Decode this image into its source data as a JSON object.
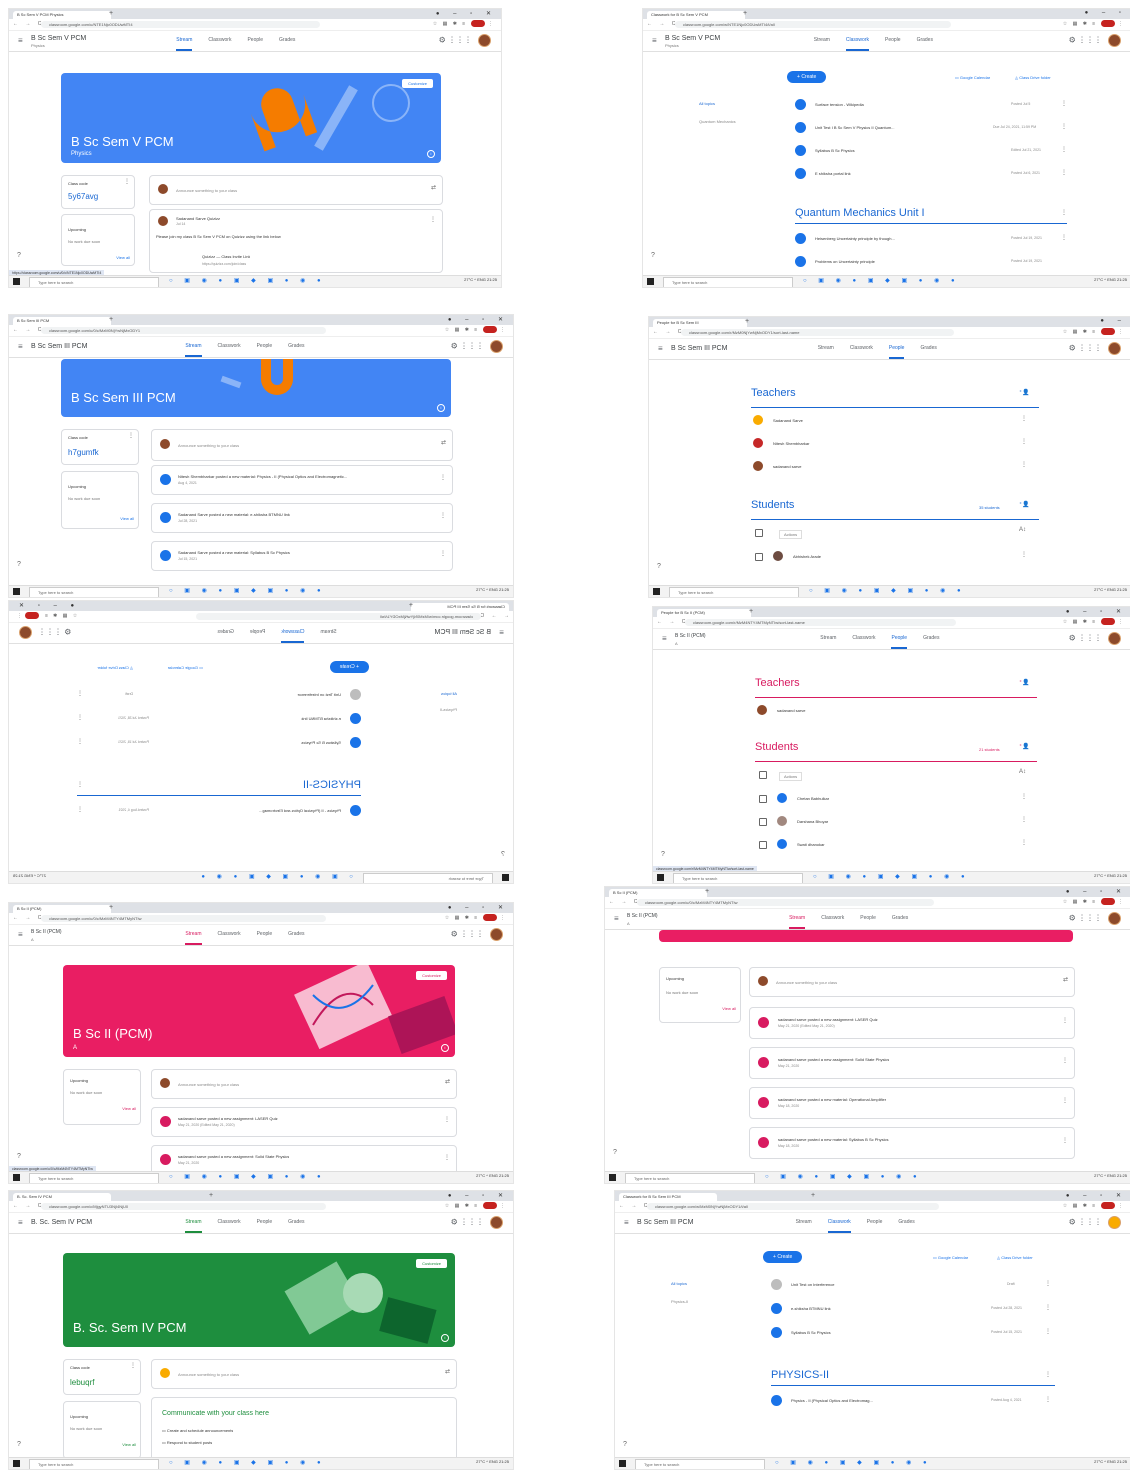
{
  "taskbar": {
    "search_placeholder": "Type here to search",
    "temp": "27°C",
    "lang": "ENG",
    "time": "21:25"
  },
  "common": {
    "tabs": [
      "Stream",
      "Classwork",
      "People",
      "Grades"
    ],
    "customize": "Customize",
    "view_all": "View all",
    "upcoming": "Upcoming",
    "no_work": "No work due soon",
    "class_code": "Class code",
    "announce": "Announce something to your class",
    "create": "Create",
    "google_calendar": "Google Calendar",
    "class_drive": "Class Drive folder",
    "all_topics": "All topics",
    "teachers": "Teachers",
    "students": "Students",
    "actions": "Actions"
  },
  "s1": {
    "tab": "B Sc Sem V PCM Physics",
    "url": "classroom.google.com/u/NTE1Njc0ODUwMTI4",
    "class": "B Sc Sem V PCM",
    "subject": "Physics",
    "code": "5y67avg",
    "post_author": "Sadanand Sarve Quizizz",
    "post_date": "Jul 14",
    "post_text": "Please join my class B Sc Sem V PCM on Quizizz using the link below",
    "post_link": "Quizizz — Class Invite Link",
    "post_url": "https://quizizz.com/join/class",
    "status_url": "https://classroom.google.com/u/0/c/NTE1Njc0ODUwMTI4"
  },
  "s2": {
    "tab": "Classwork for B Sc Sem V PCM",
    "url": "classroom.google.com/w/NTE1Njc0ODUwMTI4/t/all",
    "class": "B Sc Sem V PCM",
    "subject": "Physics",
    "topic_side": "Quantum Mechanics",
    "items": [
      {
        "t": "Surface tension - Wikipedia",
        "d": "Posted Jul 5"
      },
      {
        "t": "Unit Test I B Sc Sem V Physics II Quantum...",
        "d": "Due Jul 24, 2021, 11:59 PM"
      },
      {
        "t": "Syllabus B Sc Physics",
        "d": "Edited Jul 21, 2021"
      },
      {
        "t": "E shiksha portal link",
        "d": "Posted Jul 6, 2021"
      }
    ],
    "topic": "Quantum Mechanics Unit I",
    "titems": [
      {
        "t": "Heisenberg Uncertainty principle by though...",
        "d": "Posted Jul 19, 2021"
      },
      {
        "t": "Problems on Uncertainty principle",
        "d": "Posted Jul 19, 2021"
      }
    ]
  },
  "s3": {
    "tab": "B Sc Sem III PCM",
    "url": "classroom.google.com/u/0/c/MzM0NjYwNjMxODY1",
    "class": "B Sc Sem III PCM",
    "code": "h7gumfk",
    "posts": [
      {
        "t": "Nitesh Shembharkar posted a new material: Physics - II (Physical Optics and Electromagnetic...",
        "d": "Aug 4, 2021"
      },
      {
        "t": "Sadanand Sarve posted a new material: e-shiksha BTMNU link",
        "d": "Jul 28, 2021"
      },
      {
        "t": "Sadanand Sarve posted a new material: Syllabus B Sc Physics",
        "d": "Jul 15, 2021"
      }
    ]
  },
  "s4": {
    "tab": "People for B Sc Sem III",
    "url": "classroom.google.com/r/MzM0NjYwNjMxODY1/sort-last-name",
    "class": "B Sc Sem III PCM",
    "teachers": [
      "Sadanand Sarve",
      "Nitesh Shembharkar",
      "sadanand sarve"
    ],
    "students_count": "35 students",
    "students": [
      "Abhishek Arade",
      "Bhagyashri Bansod"
    ]
  },
  "s5": {
    "tab": "Classwork for B Sc Sem III PCM",
    "url": "classroom.google.com/w/MzM0NjYwNjMxODY1/t/all",
    "class": "B Sc Sem III PCM",
    "topic_side": "Physics-II",
    "items": [
      {
        "t": "Unit Test on Interference",
        "d": "Draft"
      },
      {
        "t": "e-shiksha BTMNU link",
        "d": "Posted Jul 28, 2021"
      },
      {
        "t": "Syllabus B Sc Physics",
        "d": "Posted Jul 15, 2021"
      }
    ],
    "topic": "PHYSICS-II",
    "titems": [
      {
        "t": "Physics - II (Physical Optics and Electromag...",
        "d": "Posted Aug 4, 2021"
      }
    ]
  },
  "s6": {
    "tab": "People for B Sc II (PCM)",
    "url": "classroom.google.com/r/MzM4NTY4MTMyNTIw/sort-last-name",
    "class": "B Sc II (PCM)",
    "section": "A",
    "teachers": [
      "sadanand sarve"
    ],
    "students_count": "21 students",
    "students": [
      "Chetan Babhulkar",
      "Darshana Bhoyar",
      "Swati dhanokar"
    ]
  },
  "s7": {
    "tab": "B Sc II (PCM)",
    "url": "classroom.google.com/u/0/c/MzM4NTY4MTMyNTIw",
    "class": "B Sc II (PCM)",
    "section": "A",
    "posts": [
      {
        "t": "sadanand sarve posted a new assignment: LASER Quiz",
        "d": "May 21, 2020 (Edited May 21, 2020)"
      },
      {
        "t": "sadanand sarve posted a new assignment: Solid State Physics",
        "d": "May 21, 2020"
      }
    ]
  },
  "s8": {
    "tab": "B Sc II (PCM)",
    "url": "classroom.google.com/u/0/c/MzM4NTY4MTMyNTIw",
    "class": "B Sc II (PCM)",
    "section": "A",
    "posts": [
      {
        "t": "sadanand sarve posted a new assignment: LASER Quiz",
        "d": "May 21, 2020 (Edited May 21, 2020)"
      },
      {
        "t": "sadanand sarve posted a new assignment: Solid State Physics",
        "d": "May 21, 2020"
      },
      {
        "t": "sadanand sarve posted a new material: Operational Amplifier",
        "d": "May 18, 2020"
      },
      {
        "t": "sadanand sarve posted a new material: Syllabus B Sc Physics",
        "d": "May 18, 2020"
      }
    ]
  },
  "s9": {
    "tab": "B. Sc. Sem IV PCM",
    "url": "classroom.google.com/c/MjgyNTU3NjI4NjU0",
    "class": "B. Sc. Sem IV PCM",
    "code": "lebuqrf",
    "communicate": "Communicate with your class here",
    "opt1": "Create and schedule announcements",
    "opt2": "Respond to student posts"
  },
  "s10": {
    "tab": "Classwork for B Sc Sem III PCM",
    "url": "classroom.google.com/w/MzM0NjYwNjMxODY1/t/all",
    "class": "B Sc Sem III PCM",
    "topic_side": "Physics-II",
    "items": [
      {
        "t": "Unit Test on Interference",
        "d": "Draft"
      },
      {
        "t": "e-shiksha BTMNU link",
        "d": "Posted Jul 28, 2021"
      },
      {
        "t": "Syllabus B Sc Physics",
        "d": "Posted Jul 15, 2021"
      }
    ],
    "topic": "PHYSICS-II",
    "titems": [
      {
        "t": "Physics - II (Physical Optics and Electromag...",
        "d": "Posted Aug 4, 2021"
      }
    ]
  },
  "colors": {
    "blue": "#1a73e8",
    "banner_blue": "#4285f4",
    "banner_pink": "#e91e63",
    "banner_green": "#1e8e3e"
  }
}
